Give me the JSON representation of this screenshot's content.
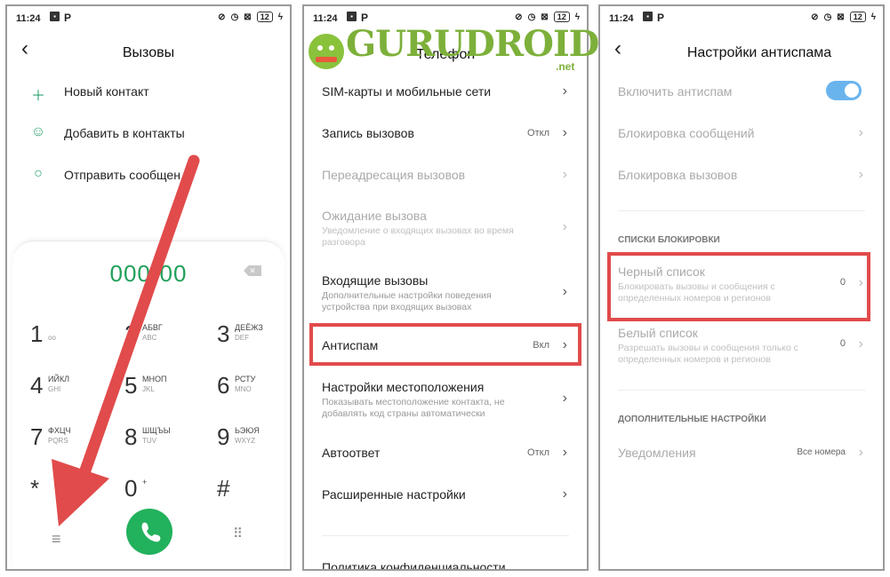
{
  "status": {
    "time": "11:24",
    "battery": "12"
  },
  "panel1": {
    "title": "Вызовы",
    "menu": [
      {
        "icon": "plus-icon",
        "label": "Новый контакт"
      },
      {
        "icon": "person-icon",
        "label": "Добавить в контакты"
      },
      {
        "icon": "chat-icon",
        "label": "Отправить сообщен"
      }
    ],
    "number": "000-00",
    "keys": [
      {
        "d": "1",
        "l1": "",
        "l2": "oo"
      },
      {
        "d": "2",
        "l1": "АБВГ",
        "l2": "ABC"
      },
      {
        "d": "3",
        "l1": "ДЕЁЖЗ",
        "l2": "DEF"
      },
      {
        "d": "4",
        "l1": "ИЙКЛ",
        "l2": "GHI"
      },
      {
        "d": "5",
        "l1": "МНОП",
        "l2": "JKL"
      },
      {
        "d": "6",
        "l1": "РСТУ",
        "l2": "MNO"
      },
      {
        "d": "7",
        "l1": "ФХЦЧ",
        "l2": "PQRS"
      },
      {
        "d": "8",
        "l1": "ШЩЪЫ",
        "l2": "TUV"
      },
      {
        "d": "9",
        "l1": "ЬЭЮЯ",
        "l2": "WXYZ"
      },
      {
        "d": "*",
        "l1": "",
        "l2": ""
      },
      {
        "d": "0",
        "l1": "+",
        "l2": ""
      },
      {
        "d": "#",
        "l1": "",
        "l2": ""
      }
    ]
  },
  "panel2": {
    "title": "Телефон",
    "logo_text": "GURUDROID",
    "logo_sub": ".net",
    "rows": [
      {
        "title": "SIM-карты и мобильные сети",
        "sub": "",
        "val": ""
      },
      {
        "title": "Запись вызовов",
        "sub": "",
        "val": "Откл"
      },
      {
        "title": "Переадресация вызовов",
        "sub": "",
        "val": ""
      },
      {
        "title": "Ожидание вызова",
        "sub": "Уведомление о входящих вызовах во время разговора",
        "val": ""
      },
      {
        "title": "Входящие вызовы",
        "sub": "Дополнительные настройки поведения устройства при входящих вызовах",
        "val": ""
      },
      {
        "title": "Антиспам",
        "sub": "",
        "val": "Вкл"
      },
      {
        "title": "Настройки местоположения",
        "sub": "Показывать местоположение контакта, не добавлять код страны автоматически",
        "val": ""
      },
      {
        "title": "Автоответ",
        "sub": "",
        "val": "Откл"
      },
      {
        "title": "Расширенные настройки",
        "sub": "",
        "val": ""
      },
      {
        "title": "Политика конфиденциальности",
        "sub": "",
        "val": ""
      }
    ]
  },
  "panel3": {
    "title": "Настройки антиспама",
    "toggle_label": "Включить антиспам",
    "rows_top": [
      {
        "title": "Блокировка сообщений"
      },
      {
        "title": "Блокировка вызовов"
      }
    ],
    "section1": "СПИСКИ БЛОКИРОВКИ",
    "black": {
      "title": "Черный список",
      "sub": "Блокировать вызовы и сообщения с определенных номеров и регионов",
      "val": "0"
    },
    "white": {
      "title": "Белый список",
      "sub": "Разрешать вызовы и сообщения только с определенных номеров и регионов",
      "val": "0"
    },
    "section2": "ДОПОЛНИТЕЛЬНЫЕ НАСТРОЙКИ",
    "notif": {
      "title": "Уведомления",
      "val": "Все номера"
    }
  },
  "colors": {
    "accent_green": "#22b15c",
    "highlight_red": "#e14b4b",
    "toggle_blue": "#6ab4ee"
  }
}
